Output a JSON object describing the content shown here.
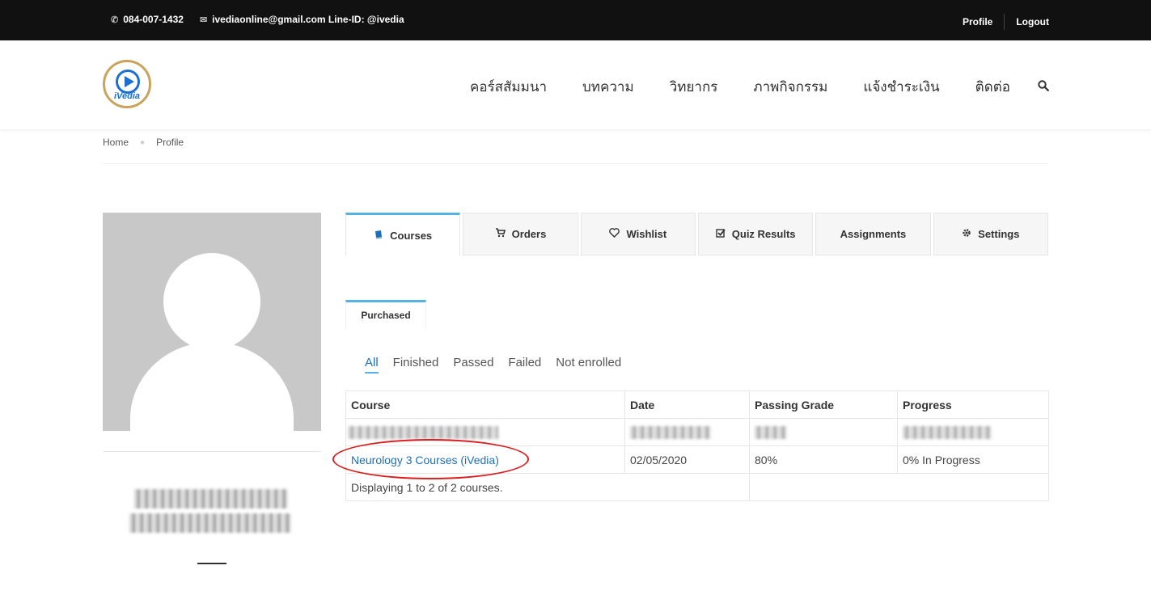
{
  "topbar": {
    "phone": "084-007-1432",
    "email_line": "ivediaonline@gmail.com Line-ID: @ivedia",
    "profile_link": "Profile",
    "logout_link": "Logout"
  },
  "brand": {
    "logo_text": "iVedia"
  },
  "nav": {
    "items": [
      "คอร์สสัมมนา",
      "บทความ",
      "วิทยากร",
      "ภาพกิจกรรม",
      "แจ้งชำระเงิน",
      "ติดต่อ"
    ]
  },
  "breadcrumb": {
    "home": "Home",
    "current": "Profile"
  },
  "tabs": {
    "courses": "Courses",
    "orders": "Orders",
    "wishlist": "Wishlist",
    "quiz_results": "Quiz Results",
    "assignments": "Assignments",
    "settings": "Settings"
  },
  "subtab": {
    "purchased": "Purchased"
  },
  "filters": [
    "All",
    "Finished",
    "Passed",
    "Failed",
    "Not enrolled"
  ],
  "table": {
    "headers": [
      "Course",
      "Date",
      "Passing Grade",
      "Progress"
    ],
    "rows": [
      {
        "course": "",
        "date": "",
        "grade": "",
        "progress": ""
      },
      {
        "course": "Neurology 3 Courses (iVedia)",
        "date": "02/05/2020",
        "grade": "80%",
        "progress": "0% In Progress"
      }
    ],
    "footer": "Displaying 1 to 2 of 2 courses."
  },
  "colors": {
    "accent": "#55b3e3",
    "link": "#1d6fb8",
    "highlight_ring": "#d81e1e"
  }
}
